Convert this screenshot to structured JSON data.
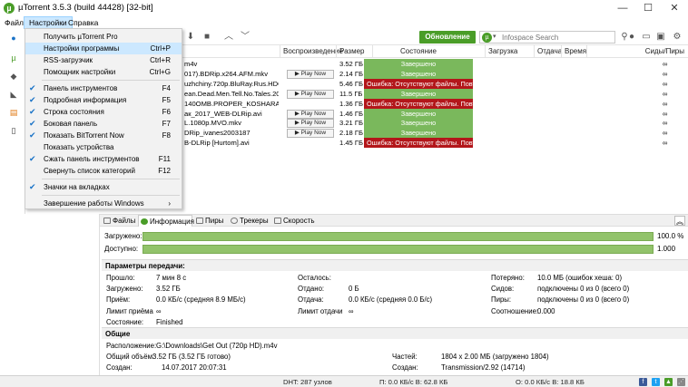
{
  "window": {
    "title": "µTorrent 3.5.3  (build 44428) [32-bit]",
    "minimize": "—",
    "maximize": "☐",
    "close": "✕"
  },
  "menubar": [
    "Файл",
    "Настройки",
    "Справка"
  ],
  "toolbar": {
    "update_label": "Обновление",
    "search_placeholder": "Infospace Search"
  },
  "list": {
    "columns": [
      "Воспроизведение",
      "Размер",
      "Состояние",
      "Загрузка",
      "Отдача",
      "Время",
      "Сиды/Пиры"
    ],
    "rows": [
      {
        "name": "m4v",
        "play": "",
        "size": "3.52 ГБ",
        "status": "Завершено",
        "err": false,
        "seeds": "∞"
      },
      {
        "name": "017).BDRip.x264.AFM.mkv",
        "play": "▶ Play Now",
        "size": "2.14 ГБ",
        "status": "Завершено",
        "err": false,
        "seeds": "∞"
      },
      {
        "name": "uzhchiny.720p.BluRay.Rus.HDC...",
        "play": "",
        "size": "5.46 ГБ",
        "status": "Ошибка: Отсутствуют файлы. Повтор",
        "err": true,
        "seeds": "∞"
      },
      {
        "name": "ean.Dead.Men.Tell.No.Tales.201...",
        "play": "▶ Play Now",
        "size": "11.5 ГБ",
        "status": "Завершено",
        "err": false,
        "seeds": "∞"
      },
      {
        "name": "140OMB.PROPER_KOSHARA.avi",
        "play": "",
        "size": "1.36 ГБ",
        "status": "Ошибка: Отсутствуют файлы. Повтор",
        "err": true,
        "seeds": "∞"
      },
      {
        "name": "ак_2017_WEB-DLRip.avi",
        "play": "▶ Play Now",
        "size": "1.46 ГБ",
        "status": "Завершено",
        "err": false,
        "seeds": "∞"
      },
      {
        "name": "L.1080p.MVO.mkv",
        "play": "▶ Play Now",
        "size": "3.21 ГБ",
        "status": "Завершено",
        "err": false,
        "seeds": "∞"
      },
      {
        "name": "DRip_ivanes2003187",
        "play": "▶ Play Now",
        "size": "2.18 ГБ",
        "status": "Завершено",
        "err": false,
        "seeds": "∞"
      },
      {
        "name": "B-DLRip [Hurtom].avi",
        "play": "",
        "size": "1.45 ГБ",
        "status": "Ошибка: Отсутствуют файлы. Повтор",
        "err": true,
        "seeds": "∞"
      }
    ]
  },
  "dropdown": [
    {
      "check": "",
      "label": "Получить µTorrent Pro",
      "sc": "",
      "hl": false
    },
    {
      "check": "",
      "label": "Настройки программы",
      "sc": "Ctrl+P",
      "hl": true
    },
    {
      "check": "",
      "label": "RSS-загрузчик",
      "sc": "Ctrl+R",
      "hl": false
    },
    {
      "check": "",
      "label": "Помощник настройки",
      "sc": "Ctrl+G",
      "hl": false
    },
    {
      "sep": true
    },
    {
      "check": "✔",
      "label": "Панель инструментов",
      "sc": "F4",
      "hl": false
    },
    {
      "check": "✔",
      "label": "Подробная информация",
      "sc": "F5",
      "hl": false
    },
    {
      "check": "✔",
      "label": "Строка состояния",
      "sc": "F6",
      "hl": false
    },
    {
      "check": "✔",
      "label": "Боковая панель",
      "sc": "F7",
      "hl": false
    },
    {
      "check": "✔",
      "label": "Показать BitTorrent Now",
      "sc": "F8",
      "hl": false
    },
    {
      "check": "",
      "label": "Показать устройства",
      "sc": "",
      "hl": false
    },
    {
      "check": "✔",
      "label": "Сжать панель инструментов",
      "sc": "F11",
      "hl": false
    },
    {
      "check": "",
      "label": "Свернуть список категорий",
      "sc": "F12",
      "hl": false
    },
    {
      "sep": true
    },
    {
      "check": "✔",
      "label": "Значки на вкладках",
      "sc": "",
      "hl": false
    },
    {
      "sep": true
    },
    {
      "check": "",
      "label": "Завершение работы Windows",
      "sc": "›",
      "hl": false
    }
  ],
  "tabs": [
    "Файлы",
    "Информация",
    "Пиры",
    "Трекеры",
    "Скорость"
  ],
  "progress": {
    "downloaded_label": "Загружено:",
    "downloaded_value": "100.0 %",
    "downloaded_fraction": 1.0,
    "available_label": "Доступно:",
    "available_value": "1.000",
    "available_fraction": 1.0
  },
  "transfer": {
    "header": "Параметры передачи:",
    "col1": [
      [
        "Прошло:",
        "7 мин 8 с"
      ],
      [
        "Загружено:",
        "3.52 ГБ"
      ],
      [
        "Приём:",
        "0.0 КБ/с (средняя 8.9 МБ/с)"
      ],
      [
        "Лимит приёма",
        "∞"
      ],
      [
        "Состояние:",
        "Finished"
      ]
    ],
    "col2": [
      [
        "Осталось:",
        ""
      ],
      [
        "Отдано:",
        "0 Б"
      ],
      [
        "Отдача:",
        "0.0 КБ/с (средняя 0.0 Б/с)"
      ],
      [
        "Лимит отдачи",
        "∞"
      ]
    ],
    "col3": [
      [
        "Потеряно:",
        "10.0 МБ (ошибок хеша: 0)"
      ],
      [
        "Сидов:",
        "подключены 0 из 0 (всего 0)"
      ],
      [
        "Пиры:",
        "подключены 0 из 0 (всего 0)"
      ],
      [
        "Соотношение:",
        "0.000"
      ]
    ]
  },
  "general": {
    "header": "Общие",
    "location_label": "Расположение:",
    "location": "G:\\Downloads\\Get Out (720p HD).m4v",
    "total_label": "Общий объём:",
    "total": "3.52 ГБ (3.52 ГБ готово)",
    "created_label": "Создан:",
    "created": "14.07.2017 20:07:31",
    "pieces_label": "Частей:",
    "pieces": "1804 x 2.00 МБ (загружено 1804)",
    "creator_label": "Создан:",
    "creator": "Transmission/2.92 (14714)"
  },
  "statusbar": {
    "dht": "DHT: 287 узлов",
    "down": "П: 0.0 КБ/с В: 62.8 КБ",
    "up": "О: 0.0 КБ/с В: 18.8 КБ"
  },
  "colors": {
    "accent": "#4a9d28",
    "ok": "#7ab85c",
    "err": "#b3161a",
    "highlight": "#cce8ff"
  }
}
